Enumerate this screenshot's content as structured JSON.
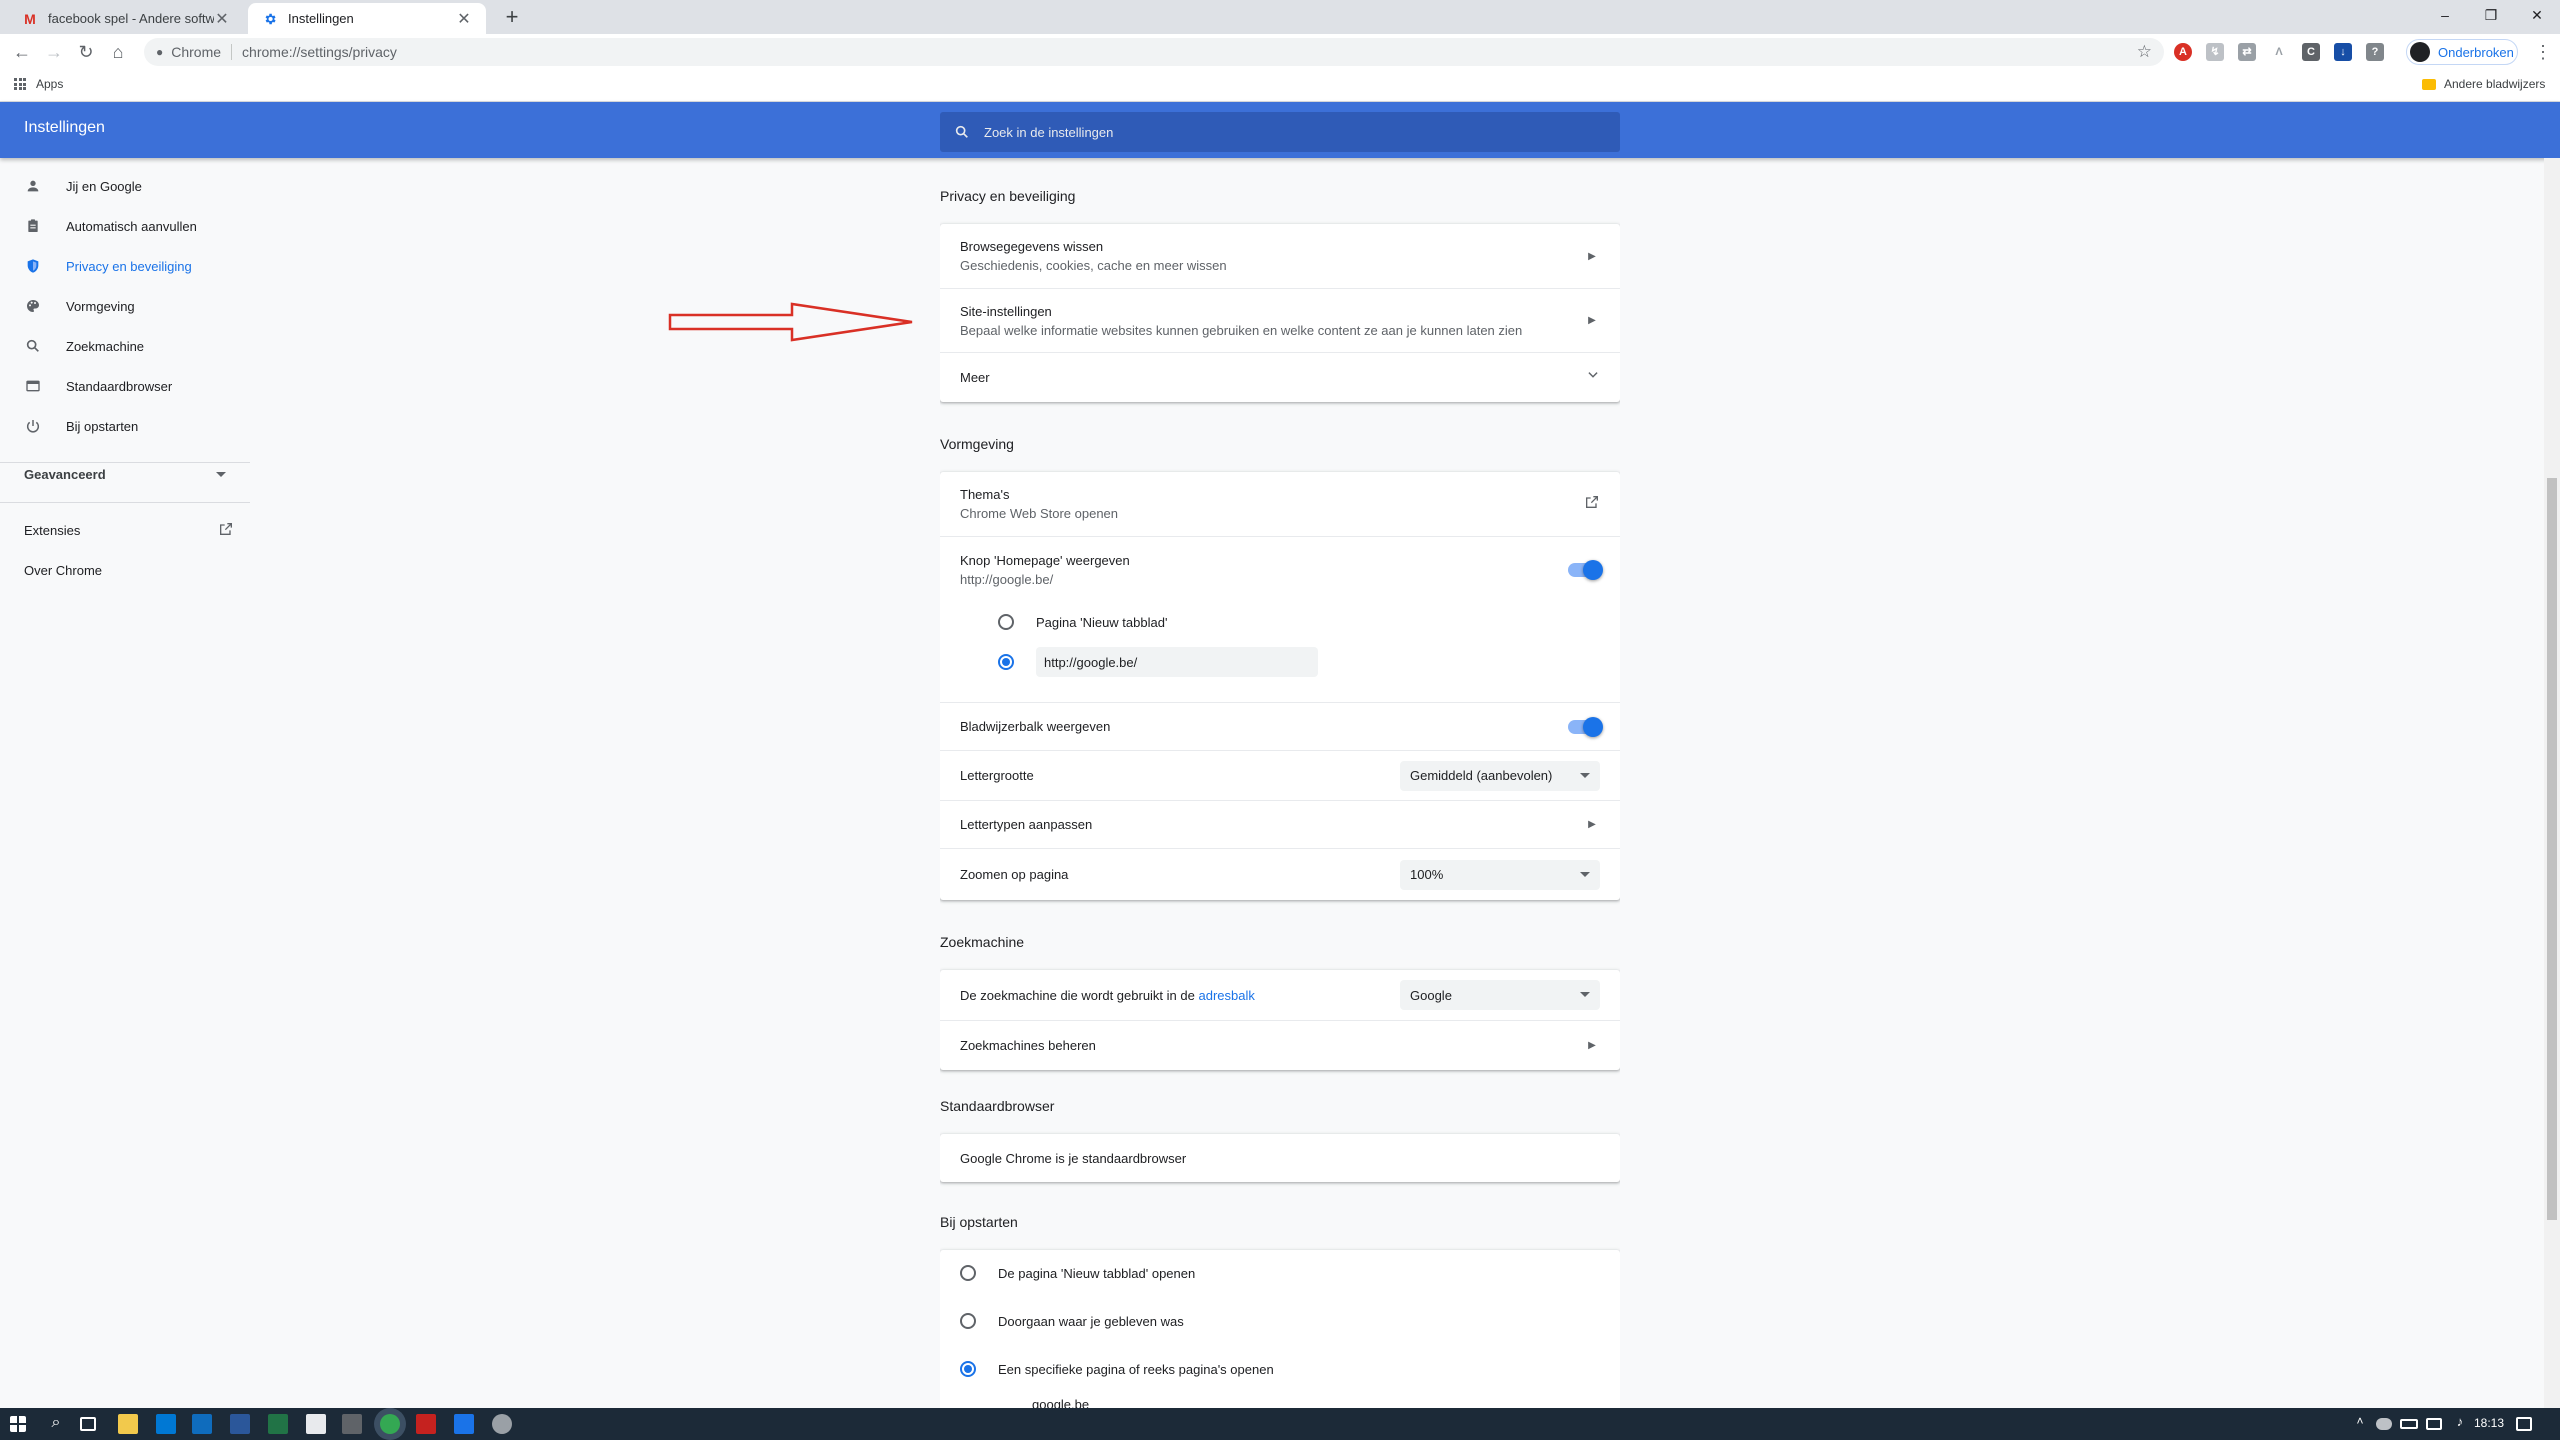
{
  "browser": {
    "tabs": [
      {
        "title": "facebook spel - Andere software",
        "icon": "gmail-icon",
        "active": false
      },
      {
        "title": "Instellingen",
        "icon": "settings-gear-icon",
        "active": true
      }
    ],
    "new_tab": "+",
    "window_controls": {
      "minimize": "–",
      "maximize": "❐",
      "close": "✕"
    },
    "omnibox": {
      "origin": "Chrome",
      "url": "chrome://settings/privacy"
    },
    "profile_label": "Onderbroken",
    "bookmarks": {
      "apps": "Apps",
      "other": "Andere bladwijzers"
    }
  },
  "settings": {
    "title": "Instellingen",
    "search_placeholder": "Zoek in de instellingen",
    "sidebar": {
      "items": [
        {
          "label": "Jij en Google",
          "icon": "person-icon"
        },
        {
          "label": "Automatisch aanvullen",
          "icon": "clipboard-icon"
        },
        {
          "label": "Privacy en beveiliging",
          "icon": "shield-icon",
          "selected": true
        },
        {
          "label": "Vormgeving",
          "icon": "palette-icon"
        },
        {
          "label": "Zoekmachine",
          "icon": "search-icon"
        },
        {
          "label": "Standaardbrowser",
          "icon": "browser-icon"
        },
        {
          "label": "Bij opstarten",
          "icon": "power-icon"
        }
      ],
      "advanced": "Geavanceerd",
      "extensions": "Extensies",
      "about": "Over Chrome"
    },
    "privacy": {
      "title": "Privacy en beveiliging",
      "clear_data": {
        "primary": "Browsegegevens wissen",
        "secondary": "Geschiedenis, cookies, cache en meer wissen"
      },
      "site_settings": {
        "primary": "Site-instellingen",
        "secondary": "Bepaal welke informatie websites kunnen gebruiken en welke content ze aan je kunnen laten zien"
      },
      "more": "Meer"
    },
    "appearance": {
      "title": "Vormgeving",
      "themes": {
        "primary": "Thema's",
        "secondary": "Chrome Web Store openen"
      },
      "home_button": {
        "primary": "Knop 'Homepage' weergeven",
        "secondary": "http://google.be/",
        "enabled": true
      },
      "home_option_newtab": "Pagina 'Nieuw tabblad'",
      "home_option_url": "http://google.be/",
      "bookmarks_bar": {
        "label": "Bladwijzerbalk weergeven",
        "enabled": true
      },
      "font_size": {
        "label": "Lettergrootte",
        "value": "Gemiddeld (aanbevolen)"
      },
      "fonts": "Lettertypen aanpassen",
      "zoom": {
        "label": "Zoomen op pagina",
        "value": "100%"
      }
    },
    "search_engine": {
      "title": "Zoekmachine",
      "label_prefix": "De zoekmachine die wordt gebruikt in de",
      "label_link": "adresbalk",
      "value": "Google",
      "manage": "Zoekmachines beheren"
    },
    "default_browser": {
      "title": "Standaardbrowser",
      "status": "Google Chrome is je standaardbrowser"
    },
    "startup": {
      "title": "Bij opstarten",
      "options": [
        {
          "label": "De pagina 'Nieuw tabblad' openen",
          "checked": false
        },
        {
          "label": "Doorgaan waar je gebleven was",
          "checked": false
        },
        {
          "label": "Een specifieke pagina of reeks pagina's openen",
          "checked": true
        }
      ],
      "partial_url": "google.be"
    }
  },
  "taskbar": {
    "time": "18:13"
  },
  "colors": {
    "accent": "#1a73e8",
    "header": "#3c70d8",
    "arrow": "#d93025"
  }
}
